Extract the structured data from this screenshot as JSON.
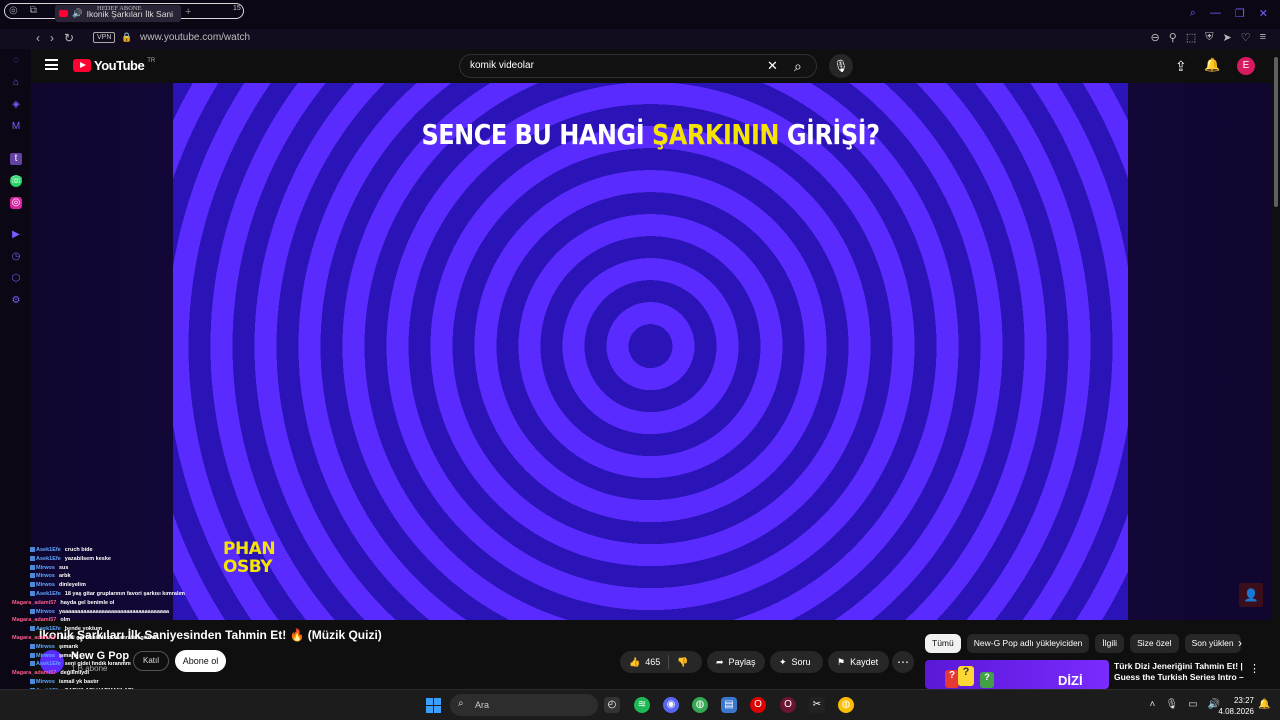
{
  "browser": {
    "tab_title": "Ikonik Şarkıları İlk Sani",
    "tab_caption": "HEDEF ABONE",
    "tab_count": "15",
    "vpn_label": "VPN",
    "url": "www.youtube.com/watch"
  },
  "youtube": {
    "wordmark": "YouTube",
    "region": "TR",
    "search_query": "komik videolar",
    "avatar_letter": "E"
  },
  "video": {
    "overlay_prefix": "SENCE BU HANGİ ",
    "overlay_highlight": "ŞARKININ",
    "overlay_suffix": " GİRİŞİ?",
    "corner_text_1": "PHAN",
    "corner_text_2": "OSBY",
    "title": "İkonik Şarkıları İlk Saniyesinden Tahmin Et! 🔥 (Müzik Quizi)",
    "channel_name": "New G Pop",
    "channel_subs": "1 B abone",
    "join_label": "Katıl",
    "subscribe_label": "Abone ol",
    "likes": "465",
    "share_label": "Paylaş",
    "ask_label": "Soru",
    "save_label": "Kaydet"
  },
  "chips": [
    "Tümü",
    "New-G Pop adlı yükleyiciden",
    "İlgili",
    "Size özel",
    "Son yüklen"
  ],
  "recommended": {
    "title": "Türk Dizi Jeneriğini Tahmin Et! | Guess the Turkish Series Intro – ...",
    "thumb_word": "DİZİ"
  },
  "chat": [
    {
      "user": "Asek1Efe",
      "color": "#5fa8ff",
      "msg": "cruch bide"
    },
    {
      "user": "Asek1Efe",
      "color": "#5fa8ff",
      "msg": "yazabilsem keske"
    },
    {
      "user": "Mirwos",
      "color": "#5fa8ff",
      "msg": "sus"
    },
    {
      "user": "Mirwos",
      "color": "#5fa8ff",
      "msg": "arbk"
    },
    {
      "user": "Mirwos",
      "color": "#5fa8ff",
      "msg": "dinleyelim"
    },
    {
      "user": "Asek1Efe",
      "color": "#5fa8ff",
      "msg": "18 yaş gitar gruplarının favori şarkısı kımralım"
    },
    {
      "user": "Magara_adami57",
      "color": "#ff5c8a",
      "msg": "hayda gel benimle ol"
    },
    {
      "user": "Mirwos",
      "color": "#5fa8ff",
      "msg": "yaaaaaaaaaaaaaaaaaaaaaaaaaaaaaaaaaaa"
    },
    {
      "user": "Magara_adami57",
      "color": "#ff5c8a",
      "msg": "olm"
    },
    {
      "user": "Asek1Efe",
      "color": "#5fa8ff",
      "msg": "bende yoktum"
    },
    {
      "user": "Magara_adami57",
      "color": "#ff5c8a",
      "msg": "haydi gel benimle ol kumralım gözleri"
    },
    {
      "user": "Mirwos",
      "color": "#5fa8ff",
      "msg": "şımarık"
    },
    {
      "user": "Mirwos",
      "color": "#5fa8ff",
      "msg": "şımarık"
    },
    {
      "user": "Asek1Efe",
      "color": "#5fa8ff",
      "msg": "seni gidei fındık kıranmm"
    },
    {
      "user": "Magara_adami57",
      "color": "#ff5c8a",
      "msg": "değilimiydi"
    },
    {
      "user": "Mirwos",
      "color": "#5fa8ff",
      "msg": "ismail yk bastır"
    },
    {
      "user": "Asek1Efe",
      "color": "#5fa8ff",
      "msg": "ŞARKILARI HARMANLARI"
    }
  ],
  "taskbar": {
    "search_label": "Ara",
    "time": "23:27",
    "date": "4.08.2026"
  }
}
